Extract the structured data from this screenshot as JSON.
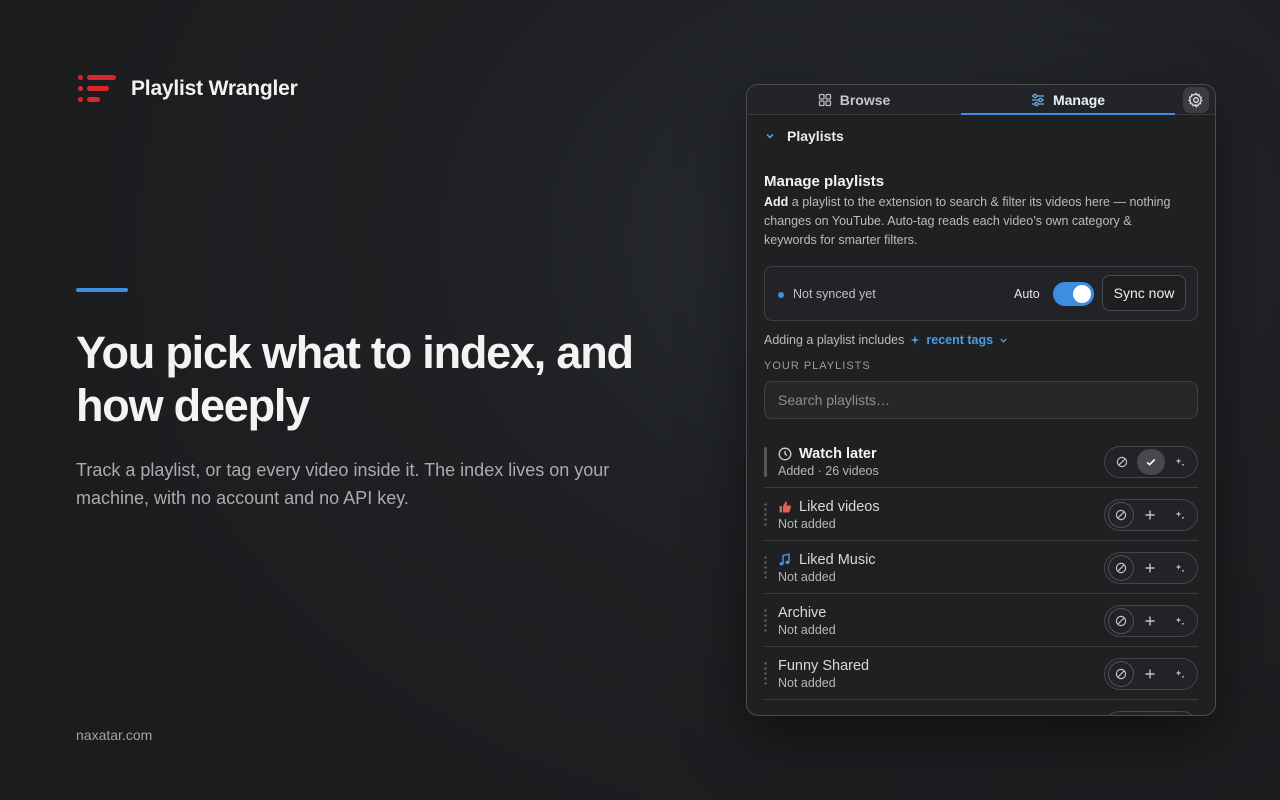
{
  "brand": {
    "name": "Playlist Wrangler",
    "logo_color": "#d8262b"
  },
  "hero": {
    "accent_color": "#3d8ee0",
    "headline": "You pick what to index, and how deeply",
    "subtext": "Track a playlist, or tag every video inside it. The index lives on your machine, with no account and no API key."
  },
  "footer": {
    "site": "naxatar.com"
  },
  "panel": {
    "tabs": [
      {
        "label": "Browse",
        "icon": "grid-icon",
        "active": false
      },
      {
        "label": "Manage",
        "icon": "sliders-icon",
        "active": true
      }
    ],
    "section": {
      "label": "Playlists"
    },
    "manage": {
      "title": "Manage playlists",
      "desc_bold": "Add",
      "desc_rest": " a playlist to the extension to search & filter its videos here — nothing changes on YouTube. Auto-tag reads each video’s own category & keywords for smarter filters."
    },
    "sync": {
      "status": "Not synced yet",
      "auto_label": "Auto",
      "auto_enabled": true,
      "button": "Sync now"
    },
    "includes": {
      "prefix": "Adding a playlist includes",
      "tag": "recent tags"
    },
    "your_playlists_label": "YOUR PLAYLISTS",
    "search_placeholder": "Search playlists…",
    "playlists": [
      {
        "name": "Watch later",
        "meta": "Added · 26 videos",
        "icon": "clock-icon",
        "state": "added"
      },
      {
        "name": "Liked videos",
        "meta": "Not added",
        "icon": "thumbs-up-icon",
        "state": "none"
      },
      {
        "name": "Liked Music",
        "meta": "Not added",
        "icon": "music-note-icon",
        "state": "none"
      },
      {
        "name": "Archive",
        "meta": "Not added",
        "icon": "",
        "state": "none"
      },
      {
        "name": "Funny Shared",
        "meta": "Not added",
        "icon": "",
        "state": "none"
      }
    ]
  }
}
